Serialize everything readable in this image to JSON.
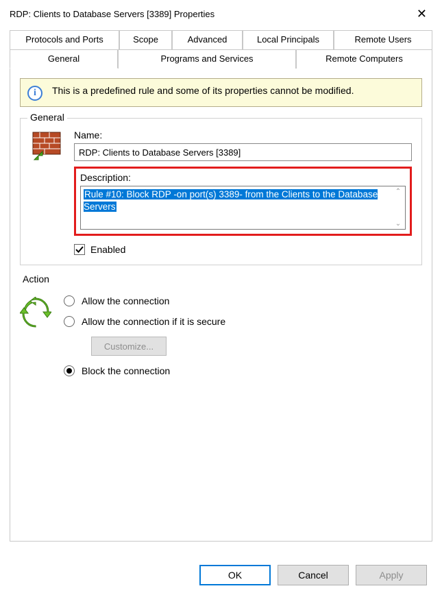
{
  "window": {
    "title": "RDP: Clients to Database Servers [3389] Properties"
  },
  "tabs": {
    "row1": [
      "Protocols and Ports",
      "Scope",
      "Advanced",
      "Local Principals",
      "Remote Users"
    ],
    "row2": [
      "General",
      "Programs and Services",
      "Remote Computers"
    ],
    "active": "General"
  },
  "info_banner": "This is a predefined rule and some of its properties cannot be modified.",
  "general": {
    "group_title": "General",
    "name_label": "Name:",
    "name_value": "RDP: Clients to Database Servers [3389]",
    "description_label": "Description:",
    "description_value": "Rule #10: Block RDP -on port(s) 3389- from the Clients to the Database Servers",
    "enabled_label": "Enabled",
    "enabled_checked": true
  },
  "action": {
    "group_title": "Action",
    "allow_label": "Allow the connection",
    "allow_secure_label": "Allow the connection if it is secure",
    "customize_label": "Customize...",
    "block_label": "Block the connection",
    "selected": "block"
  },
  "buttons": {
    "ok": "OK",
    "cancel": "Cancel",
    "apply": "Apply"
  }
}
